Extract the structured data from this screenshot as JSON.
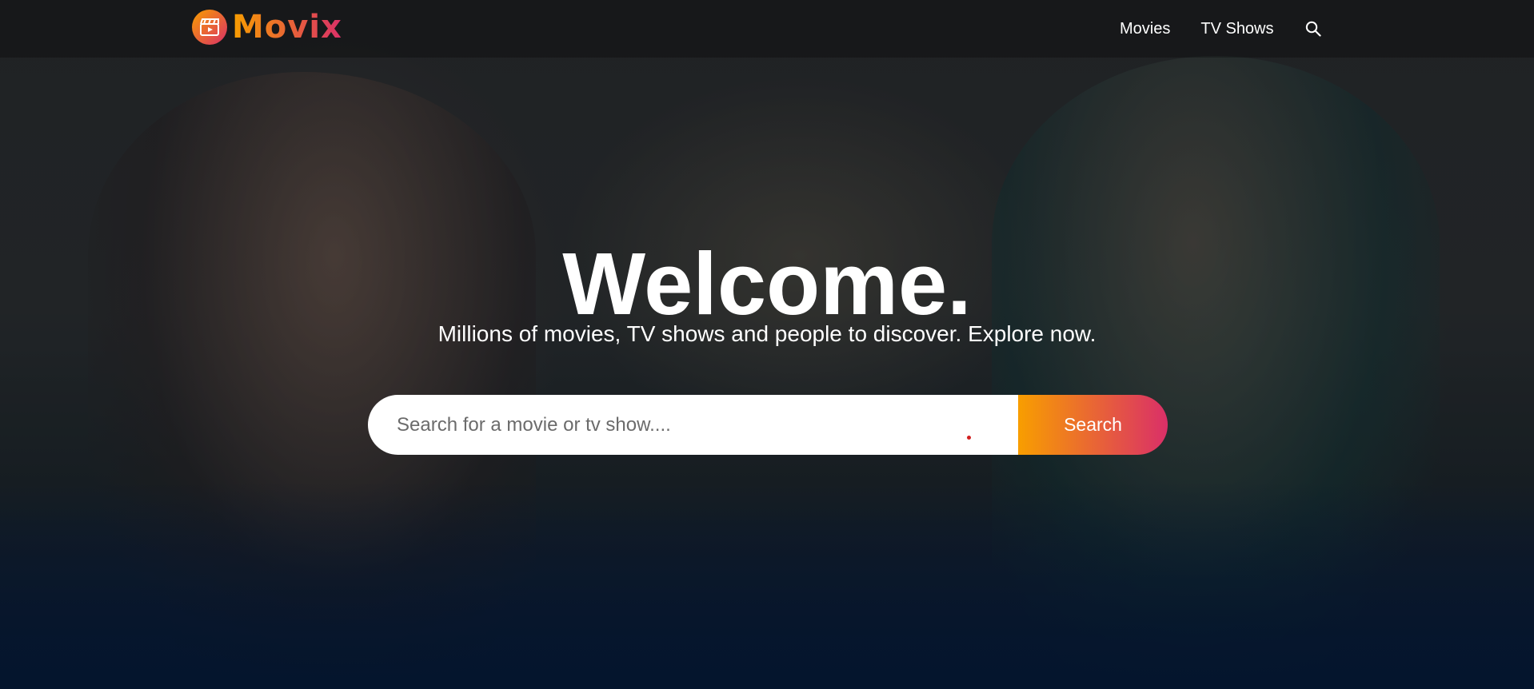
{
  "header": {
    "logo_text": "Movix",
    "nav": [
      {
        "label": "Movies"
      },
      {
        "label": "TV Shows"
      }
    ],
    "search_icon": "search-icon"
  },
  "hero": {
    "title": "Welcome.",
    "subtitle": "Millions of movies, TV shows and people to discover. Explore now.",
    "search": {
      "placeholder": "Search for a movie or tv show....",
      "value": "",
      "button_label": "Search"
    }
  },
  "colors": {
    "accent_start": "#f89e00",
    "accent_end": "#da2f68",
    "background": "#04152d"
  }
}
